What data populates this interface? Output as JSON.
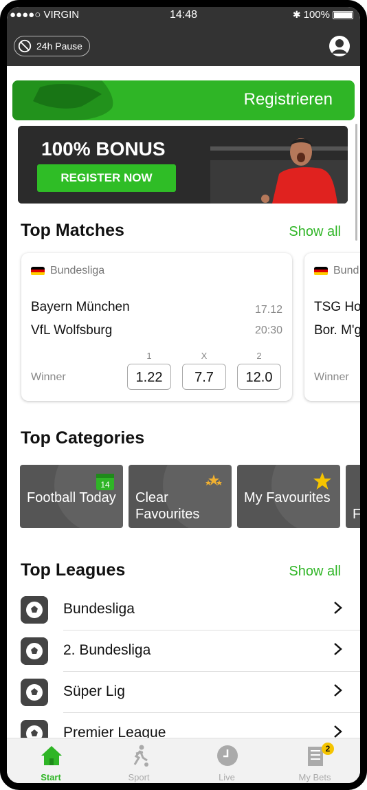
{
  "status_bar": {
    "carrier": "●●●●○ VIRGIN",
    "time": "14:48",
    "battery": "100%"
  },
  "header": {
    "pause_label": "24h Pause"
  },
  "register_banner": {
    "label": "Registrieren"
  },
  "bonus_banner": {
    "title": "100% BONUS",
    "button": "REGISTER NOW"
  },
  "top_matches": {
    "title": "Top Matches",
    "show_all": "Show all",
    "matches": [
      {
        "league": "Bundesliga",
        "team1": "Bayern München",
        "team2": "VfL Wolfsburg",
        "date": "17.12",
        "time": "20:30",
        "market": "Winner",
        "odds": [
          {
            "label": "1",
            "value": "1.22"
          },
          {
            "label": "X",
            "value": "7.7"
          },
          {
            "label": "2",
            "value": "12.0"
          }
        ]
      },
      {
        "league": "Bund",
        "team1": "TSG Ho",
        "team2": "Bor. M'g",
        "market": "Winner"
      }
    ]
  },
  "top_categories": {
    "title": "Top Categories",
    "items": [
      {
        "label": "Football Today",
        "icon": "calendar-icon",
        "icon_text": "14"
      },
      {
        "label": "Clear Favourites",
        "icon": "stars-icon"
      },
      {
        "label": "My Favourites",
        "icon": "star-icon"
      },
      {
        "label": "F",
        "icon": ""
      }
    ]
  },
  "top_leagues": {
    "title": "Top Leagues",
    "show_all": "Show all",
    "items": [
      {
        "name": "Bundesliga"
      },
      {
        "name": "2. Bundesliga"
      },
      {
        "name": "Süper Lig"
      },
      {
        "name": "Premier League"
      }
    ]
  },
  "tabbar": {
    "items": [
      {
        "label": "Start",
        "icon": "home-icon"
      },
      {
        "label": "Sport",
        "icon": "soccer-player-icon"
      },
      {
        "label": "Live",
        "icon": "clock-icon"
      },
      {
        "label": "My Bets",
        "icon": "betslip-icon",
        "badge": "2"
      }
    ]
  },
  "colors": {
    "accent": "#2fb526",
    "header": "#333333",
    "category_tile": "#555555"
  }
}
